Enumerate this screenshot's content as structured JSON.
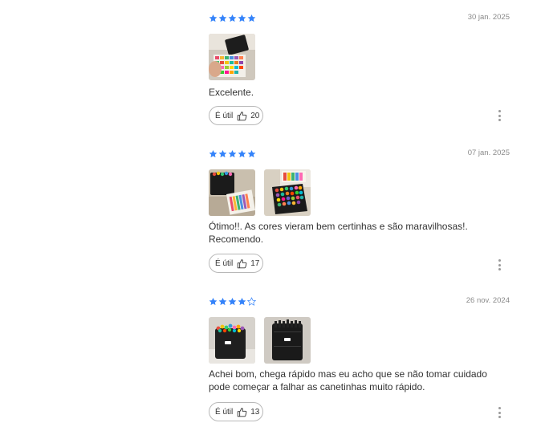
{
  "colors": {
    "star": "#3483fa",
    "star_empty": "#3483fa",
    "text": "#333333",
    "date": "#8a8a8a"
  },
  "reviews": [
    {
      "rating": 5,
      "date": "30 jan. 2025",
      "text": "Excelente.",
      "useful_label": "É útil",
      "useful_count": "20",
      "photos": [
        "markers-pack-photo"
      ]
    },
    {
      "rating": 5,
      "date": "07 jan. 2025",
      "text": "Ótimo!!. As cores vieram bem certinhas e são maravilhosas!. Recomendo.",
      "useful_label": "É útil",
      "useful_count": "17",
      "photos": [
        "markers-case-photo",
        "markers-open-case-photo"
      ]
    },
    {
      "rating": 4,
      "date": "26 nov. 2024",
      "text": "Achei bom, chega rápido mas eu acho que se não tomar cuidado pode começar a falhar as canetinhas muito rápido.",
      "useful_label": "É útil",
      "useful_count": "13",
      "photos": [
        "markers-case-front-photo",
        "markers-case-back-photo"
      ]
    }
  ],
  "icons": {
    "star": "star-icon",
    "thumb": "thumbs-up-icon",
    "more": "more-options-icon"
  }
}
